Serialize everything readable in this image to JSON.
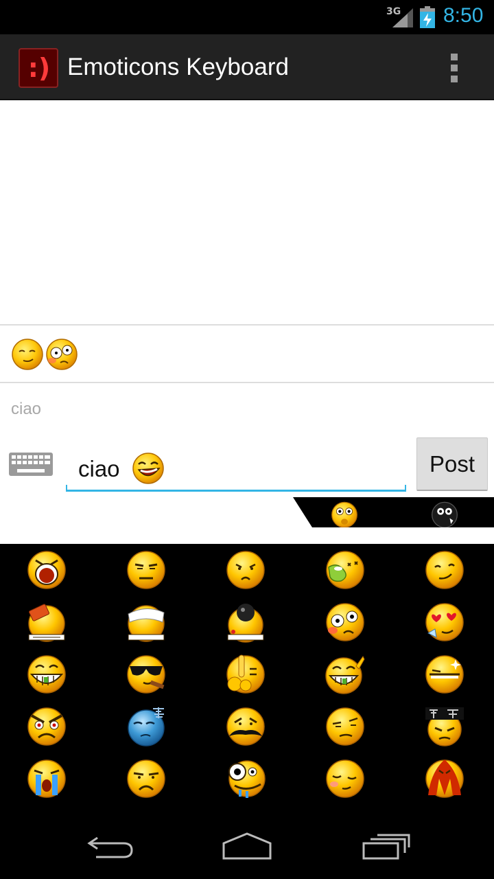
{
  "status_bar": {
    "network": "3G",
    "time": "8:50",
    "accent_color": "#33b5e5"
  },
  "action_bar": {
    "app_icon_glyph": ":)",
    "title": "Emoticons Keyboard",
    "overflow_icon": "overflow-menu-icon"
  },
  "selected_emoticons": [
    "smug-face",
    "dizzy-face"
  ],
  "compose": {
    "hint": "ciao",
    "input_value": "ciao",
    "input_emoticon": "laughing-face",
    "post_label": "Post",
    "keyboard_icon": "keyboard-icon"
  },
  "tabs": [
    "worried-face",
    "dark-face"
  ],
  "emoticon_grid": [
    [
      "screaming-face",
      "annoyed-face",
      "confused-face",
      "vomiting-face",
      "smug-face"
    ],
    [
      "brick-hit-face",
      "bandaged-face",
      "bomb-face",
      "dizzy-face",
      "heart-eyes-face"
    ],
    [
      "grinning-face",
      "sunglasses-cigar-face",
      "shushing-face",
      "thumbs-up-grin-face",
      "sparkle-face"
    ],
    [
      "angry-face",
      "freezing-face",
      "mustache-face",
      "skeptical-face",
      "sign-holding-face"
    ],
    [
      "crying-face",
      "frowning-face",
      "drooling-face",
      "sleepy-face",
      "bleeding-face"
    ]
  ],
  "nav_bar": {
    "back": "back-icon",
    "home": "home-icon",
    "recents": "recents-icon"
  }
}
